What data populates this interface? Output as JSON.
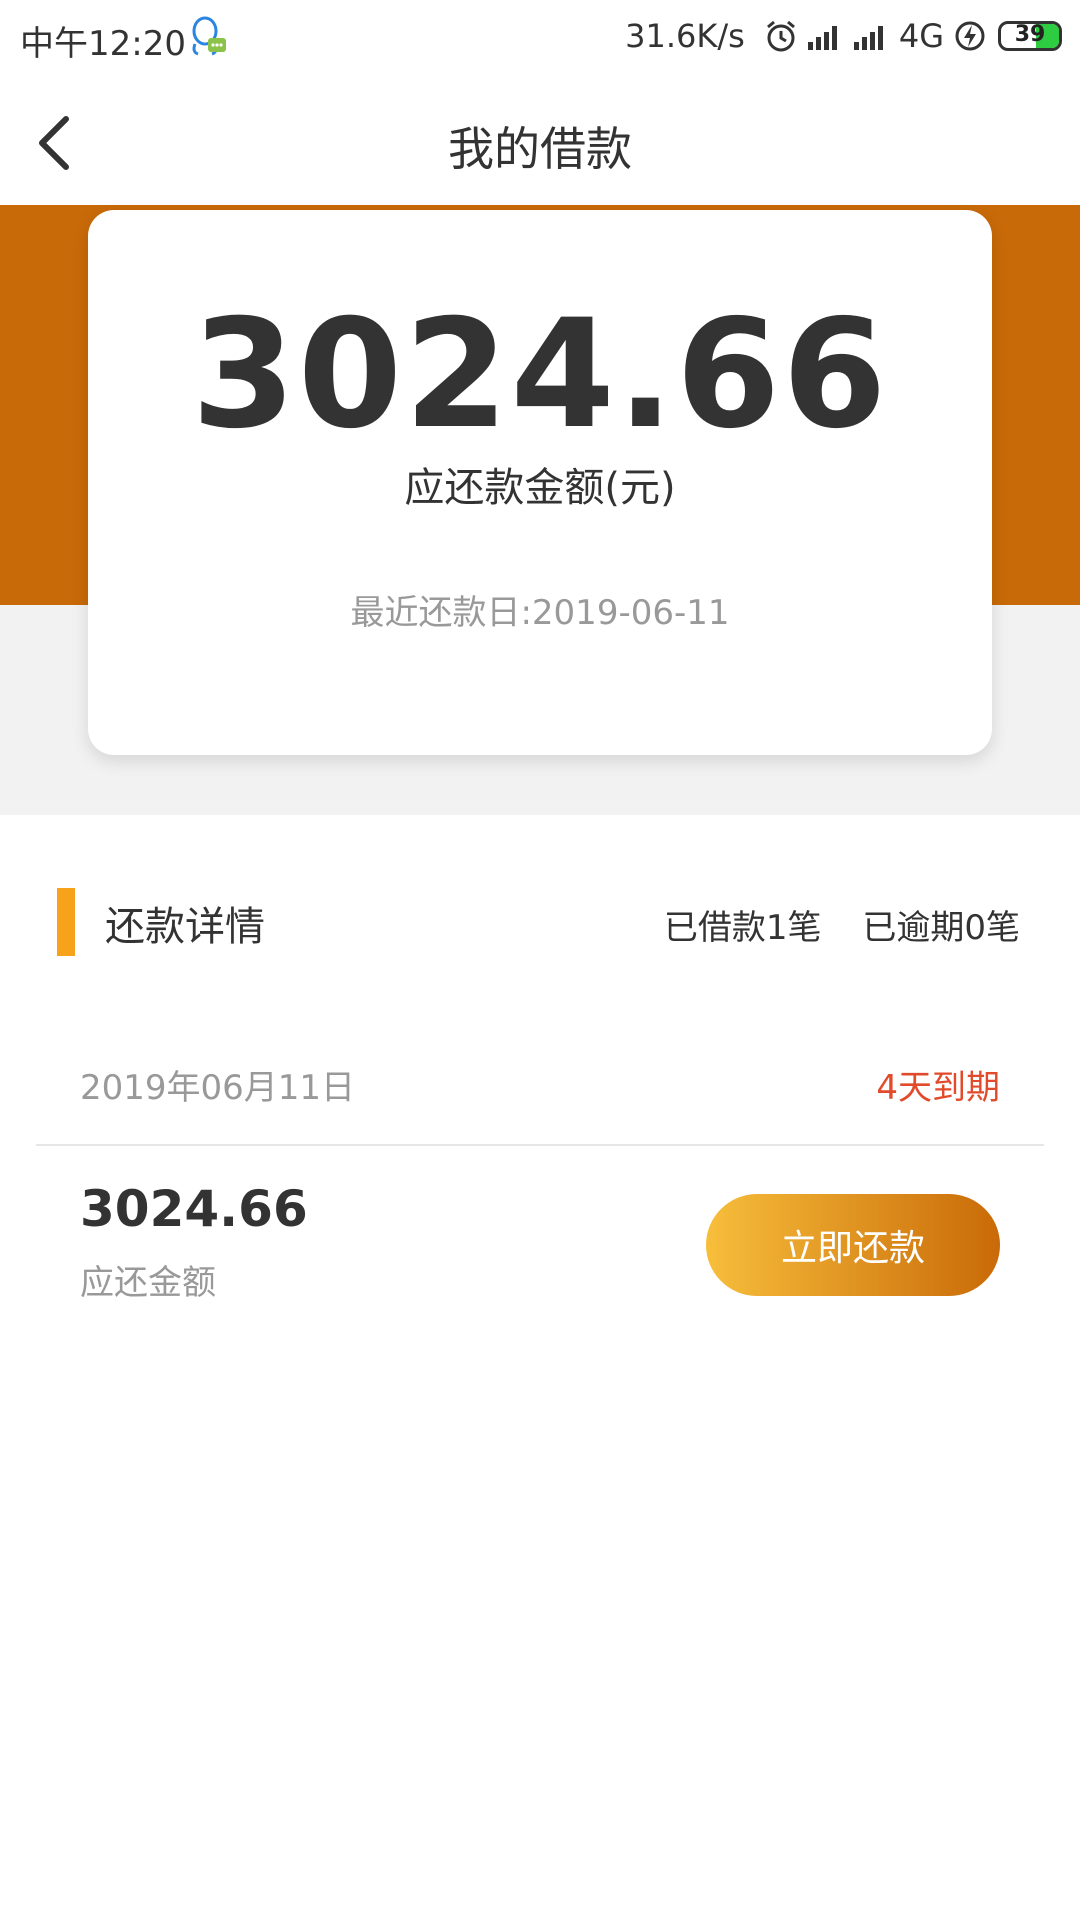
{
  "status_bar": {
    "time": "中午12:20",
    "speed": "31.6K/s",
    "network": "4G",
    "battery": "39",
    "icons": [
      "qq-notification-icon",
      "alarm-icon",
      "signal-icon",
      "signal-icon",
      "charging-icon",
      "battery-icon"
    ]
  },
  "header": {
    "title": "我的借款",
    "back_icon": "chevron-left-icon"
  },
  "summary": {
    "amount": "3024.66",
    "amount_label": "应还款金额(元)",
    "recent_date": "最近还款日:2019-06-11"
  },
  "details": {
    "title": "还款详情",
    "borrowed_count": "已借款1笔",
    "overdue_count": "已逾期0笔",
    "item": {
      "date": "2019年06月11日",
      "status": "4天到期",
      "amount": "3024.66",
      "amount_label": "应还金额",
      "button_label": "立即还款"
    }
  },
  "colors": {
    "brand_orange": "#c96a08",
    "accent_bar": "#f7a21b",
    "due_red": "#e14b2b",
    "button_gradient_start": "#f7be3b",
    "button_gradient_end": "#c96a08"
  }
}
